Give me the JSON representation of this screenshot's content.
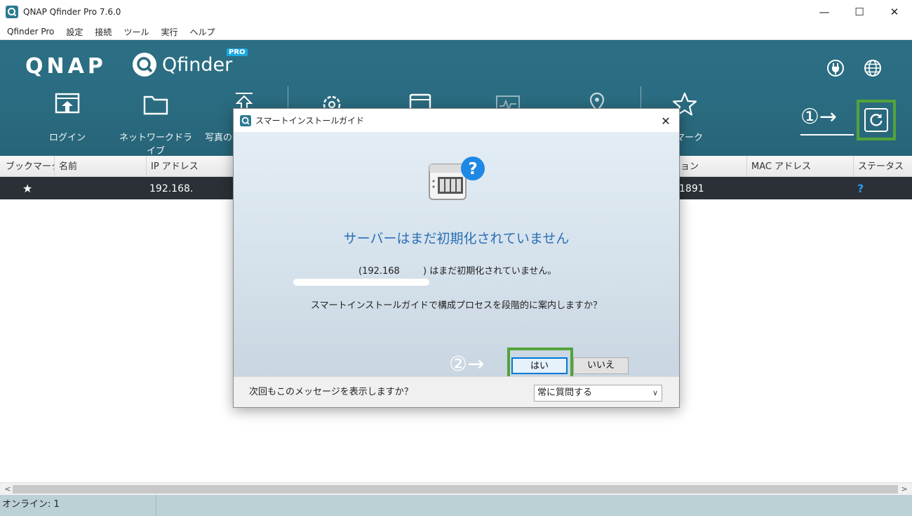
{
  "window": {
    "title": "QNAP Qfinder Pro 7.6.0",
    "controls": {
      "minimize": "—",
      "maximize": "☐",
      "close": "✕"
    }
  },
  "menu": [
    "Qfinder Pro",
    "設定",
    "接続",
    "ツール",
    "実行",
    "ヘルプ"
  ],
  "header": {
    "brand": "QNAP",
    "product": "Qfinder",
    "badge": "PRO",
    "icons": [
      "power-plug-icon",
      "globe-icon",
      "refresh-icon"
    ]
  },
  "toolbar": [
    {
      "label": "ログイン",
      "icon": "login-icon"
    },
    {
      "label": "ネットワークドライブ",
      "icon": "folder-icon"
    },
    {
      "label": "写真の",
      "icon": "upload-icon"
    },
    {
      "label": "",
      "icon": "gear-icon"
    },
    {
      "label": "",
      "icon": "storage-icon"
    },
    {
      "label": "",
      "icon": "monitor-icon"
    },
    {
      "label": "",
      "icon": "location-pin-icon"
    },
    {
      "label": "ブックマーク",
      "icon": "star-icon"
    }
  ],
  "toolbar_visible_labels": {
    "bookmark_partial": "クマーク"
  },
  "annotations": {
    "step1": "①→",
    "step2": "②→"
  },
  "table": {
    "columns": [
      "ブックマーク",
      "名前",
      "IP アドレス",
      "ョン",
      "MAC アドレス",
      "ステータス"
    ],
    "row": {
      "bookmark": "★",
      "ip": "192.168.",
      "version": "1891",
      "status": "?"
    }
  },
  "status": {
    "online": "オンライン: 1"
  },
  "dialog": {
    "title": "スマートインストールガイド",
    "close": "✕",
    "heading": "サーバーはまだ初期化されていません",
    "ip_prefix": "(192.168",
    "ip_suffix": ") はまだ初期化されていません。",
    "question": "スマートインストールガイドで構成プロセスを段階的に案内しますか？",
    "yes": "はい",
    "no": "いいえ",
    "footer_label": "次回もこのメッセージを表示しますか？",
    "select_value": "常に質問する",
    "colors": {
      "heading": "#2a6fb6",
      "highlight": "#54a33a"
    }
  },
  "scroll": {
    "left": "<",
    "right": ">"
  }
}
